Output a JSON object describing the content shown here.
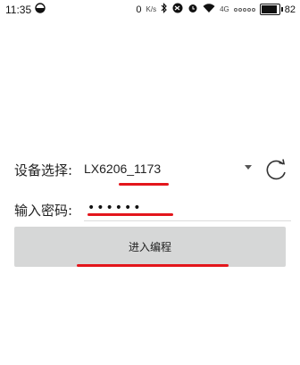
{
  "status_bar": {
    "time": "11:35",
    "network_speed": "0",
    "network_unit": "K/s",
    "network_type": "4G",
    "battery_level": "82",
    "icons": [
      "circle-half-icon",
      "bluetooth-icon",
      "alarm-icon",
      "wifi-icon",
      "signal-icon",
      "battery-icon"
    ]
  },
  "form": {
    "device_label": "设备选择:",
    "device_value": "LX6206_1173",
    "password_label": "输入密码:",
    "password_value": "••••••",
    "submit_label": "进入编程"
  },
  "colors": {
    "annotation_red": "#e3161c",
    "button_bg": "#d6d7d7"
  }
}
